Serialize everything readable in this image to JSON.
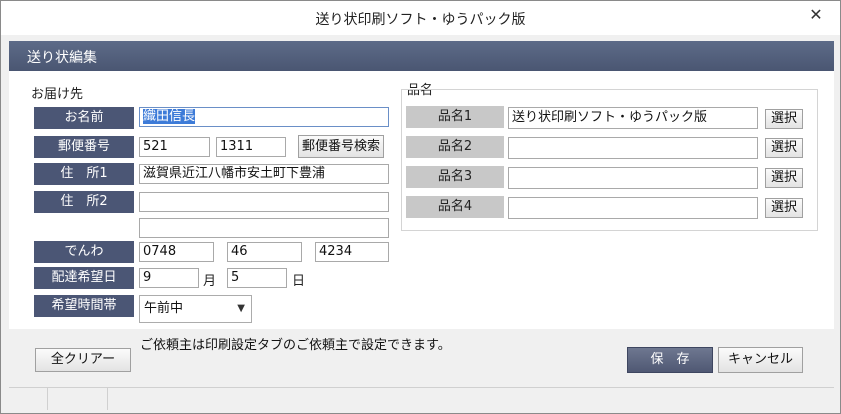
{
  "window": {
    "title": "送り状印刷ソフト・ゆうパック版",
    "close_glyph": "✕"
  },
  "header": {
    "title": "送り状編集"
  },
  "destination": {
    "section_label": "お届け先",
    "name_label": "お名前",
    "name_value": "織田信長",
    "postal_label": "郵便番号",
    "postal_1": "521",
    "postal_2": "1311",
    "postal_search_button": "郵便番号検索",
    "address1_label": "住　所1",
    "address1_value": "滋賀県近江八幡市安土町下豊浦",
    "address2_label": "住　所2",
    "address2_value": "",
    "address3_value": "",
    "phone_label": "でんわ",
    "phone_1": "0748",
    "phone_2": "46",
    "phone_3": "4234",
    "delivery_date_label": "配達希望日",
    "month_value": "9",
    "month_unit": "月",
    "day_value": "5",
    "day_unit": "日",
    "time_label": "希望時間帯",
    "time_value": "午前中"
  },
  "items": {
    "section_label": "品名",
    "select_button": "選択",
    "rows": [
      {
        "label": "品名1",
        "value": "送り状印刷ソフト・ゆうパック版"
      },
      {
        "label": "品名2",
        "value": ""
      },
      {
        "label": "品名3",
        "value": ""
      },
      {
        "label": "品名4",
        "value": ""
      }
    ]
  },
  "note": "ご依頼主は印刷設定タブのご依頼主で設定できます。",
  "buttons": {
    "clear": "全クリアー",
    "save": "保　存",
    "cancel": "キャンセル"
  },
  "colors": {
    "label_bg": "#4b5675",
    "header_bg": "#4a5672",
    "item_label_bg": "#c8c8c8"
  }
}
